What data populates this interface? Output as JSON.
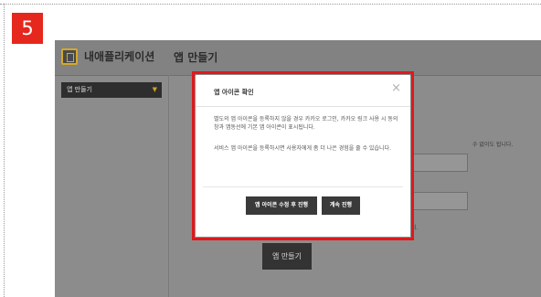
{
  "step": {
    "number": "5",
    "color": "#e6271d"
  },
  "app": {
    "title": "내애플리케이션",
    "page_heading": "앱 만들기",
    "logo_icon": "app-box-icon",
    "accent": "#d4a92a"
  },
  "sidebar": {
    "select_value": "앱 만들기",
    "caret_icon": "caret-down-icon"
  },
  "background": {
    "hint_text": "수 없이도 됩니다.",
    "note_text": "되.",
    "create_button": "앱 만들기"
  },
  "modal": {
    "title": "앱 아이콘 확인",
    "close_icon": "close-icon",
    "close_glyph": "×",
    "paragraph1": "별도의 앱 아이콘을 등록하지 않을 경우 카카오 로그인, 카카오 링크 사용 시 동의창과 앱동선에 기본 앱 아이콘이 표시됩니다.",
    "paragraph2": "서비스 앱 아이콘을 등록하시면 사용자에게 좀 더 나은 경험을 줄 수 있습니다.",
    "edit_button": "앱 아이콘 수정 후 진행",
    "continue_button": "계속 진행",
    "highlight_color": "#e0181b"
  }
}
